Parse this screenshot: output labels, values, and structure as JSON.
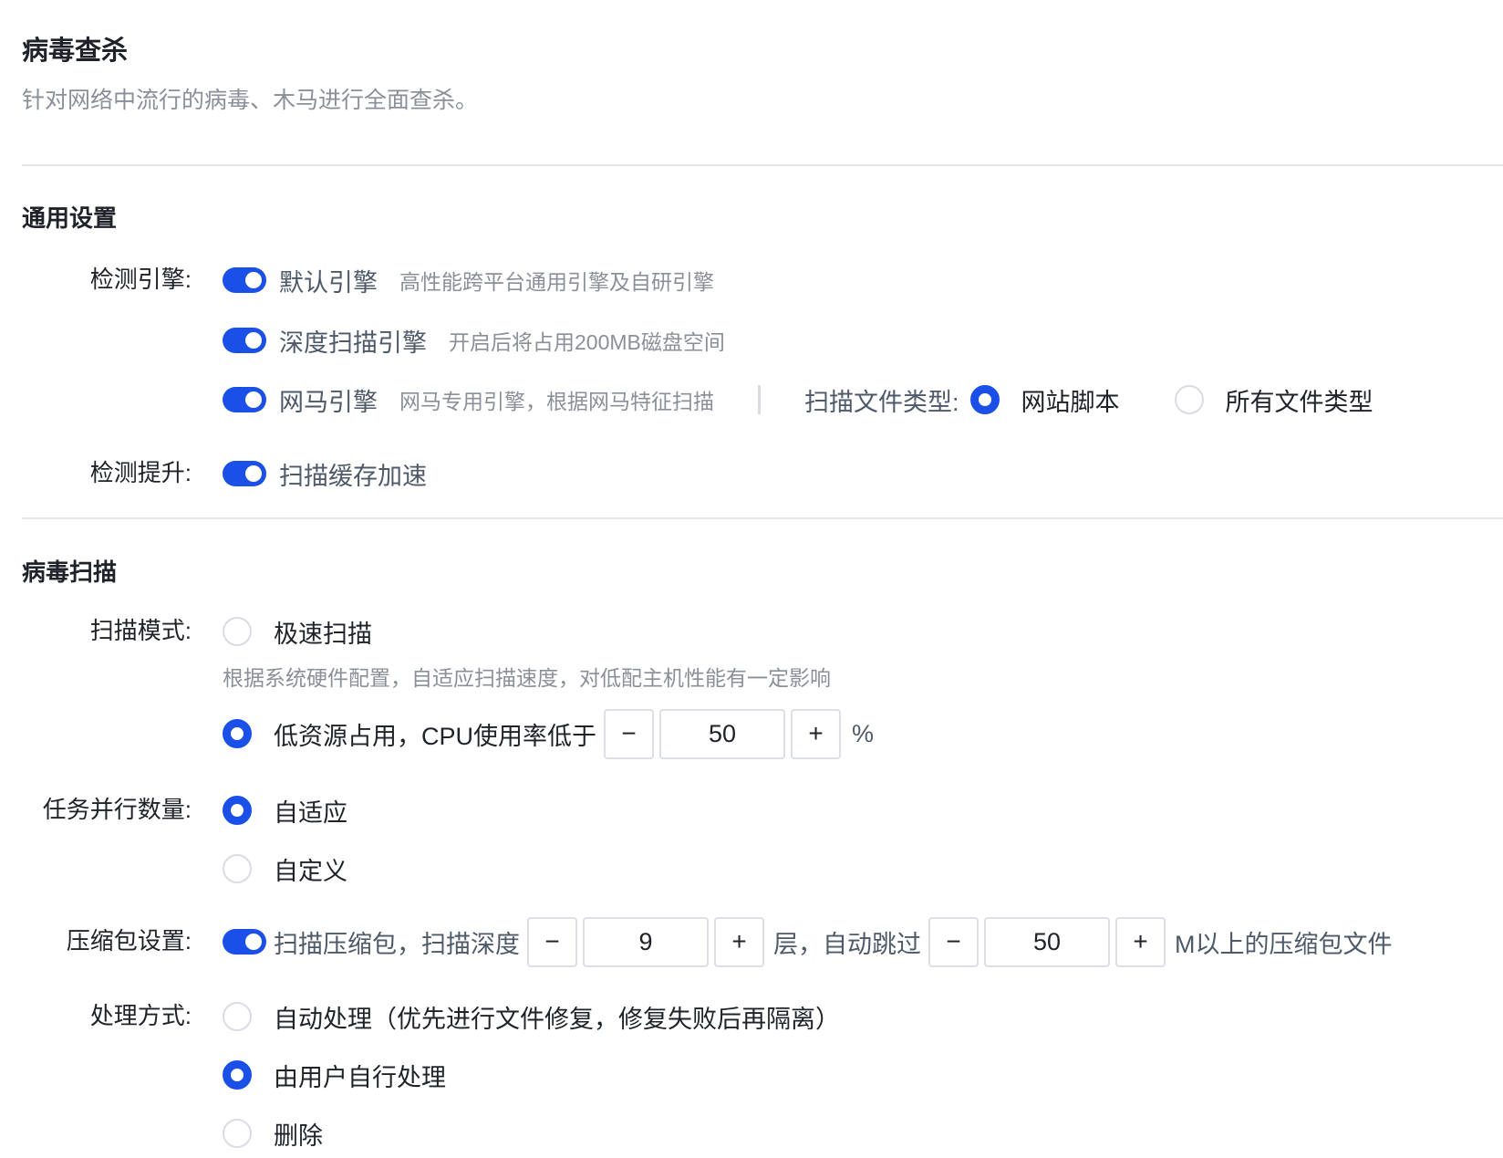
{
  "header": {
    "title": "病毒查杀",
    "subtitle": "针对网络中流行的病毒、木马进行全面查杀。"
  },
  "general": {
    "title": "通用设置",
    "engine_label": "检测引擎:",
    "engines": [
      {
        "name": "默认引擎",
        "desc": "高性能跨平台通用引擎及自研引擎",
        "enabled": true
      },
      {
        "name": "深度扫描引擎",
        "desc": "开启后将占用200MB磁盘空间",
        "enabled": true
      },
      {
        "name": "网马引擎",
        "desc": "网马专用引擎，根据网马特征扫描",
        "enabled": true
      }
    ],
    "file_type_label": "扫描文件类型:",
    "file_types": [
      {
        "label": "网站脚本",
        "selected": true
      },
      {
        "label": "所有文件类型",
        "selected": false
      }
    ],
    "boost_label": "检测提升:",
    "boost": {
      "name": "扫描缓存加速",
      "enabled": true
    }
  },
  "scan": {
    "title": "病毒扫描",
    "mode_label": "扫描模式:",
    "fast": {
      "label": "极速扫描",
      "hint": "根据系统硬件配置，自适应扫描速度，对低配主机性能有一定影响",
      "selected": false
    },
    "low": {
      "label": "低资源占用，CPU使用率低于",
      "value": "50",
      "unit": "%",
      "selected": true
    },
    "parallel_label": "任务并行数量:",
    "parallel": [
      {
        "label": "自适应",
        "selected": true
      },
      {
        "label": "自定义",
        "selected": false
      }
    ],
    "archive_label": "压缩包设置:",
    "archive": {
      "enabled": true,
      "text1": "扫描压缩包，扫描深度",
      "depth": "9",
      "text2": "层，自动跳过",
      "size": "50",
      "text3": "M以上的压缩包文件"
    },
    "handle_label": "处理方式:",
    "handle": [
      {
        "label": "自动处理（优先进行文件修复，修复失败后再隔离）",
        "selected": false
      },
      {
        "label": "由用户自行处理",
        "selected": true
      },
      {
        "label": "删除",
        "selected": false
      }
    ]
  },
  "stepper": {
    "minus": "−",
    "plus": "+"
  }
}
